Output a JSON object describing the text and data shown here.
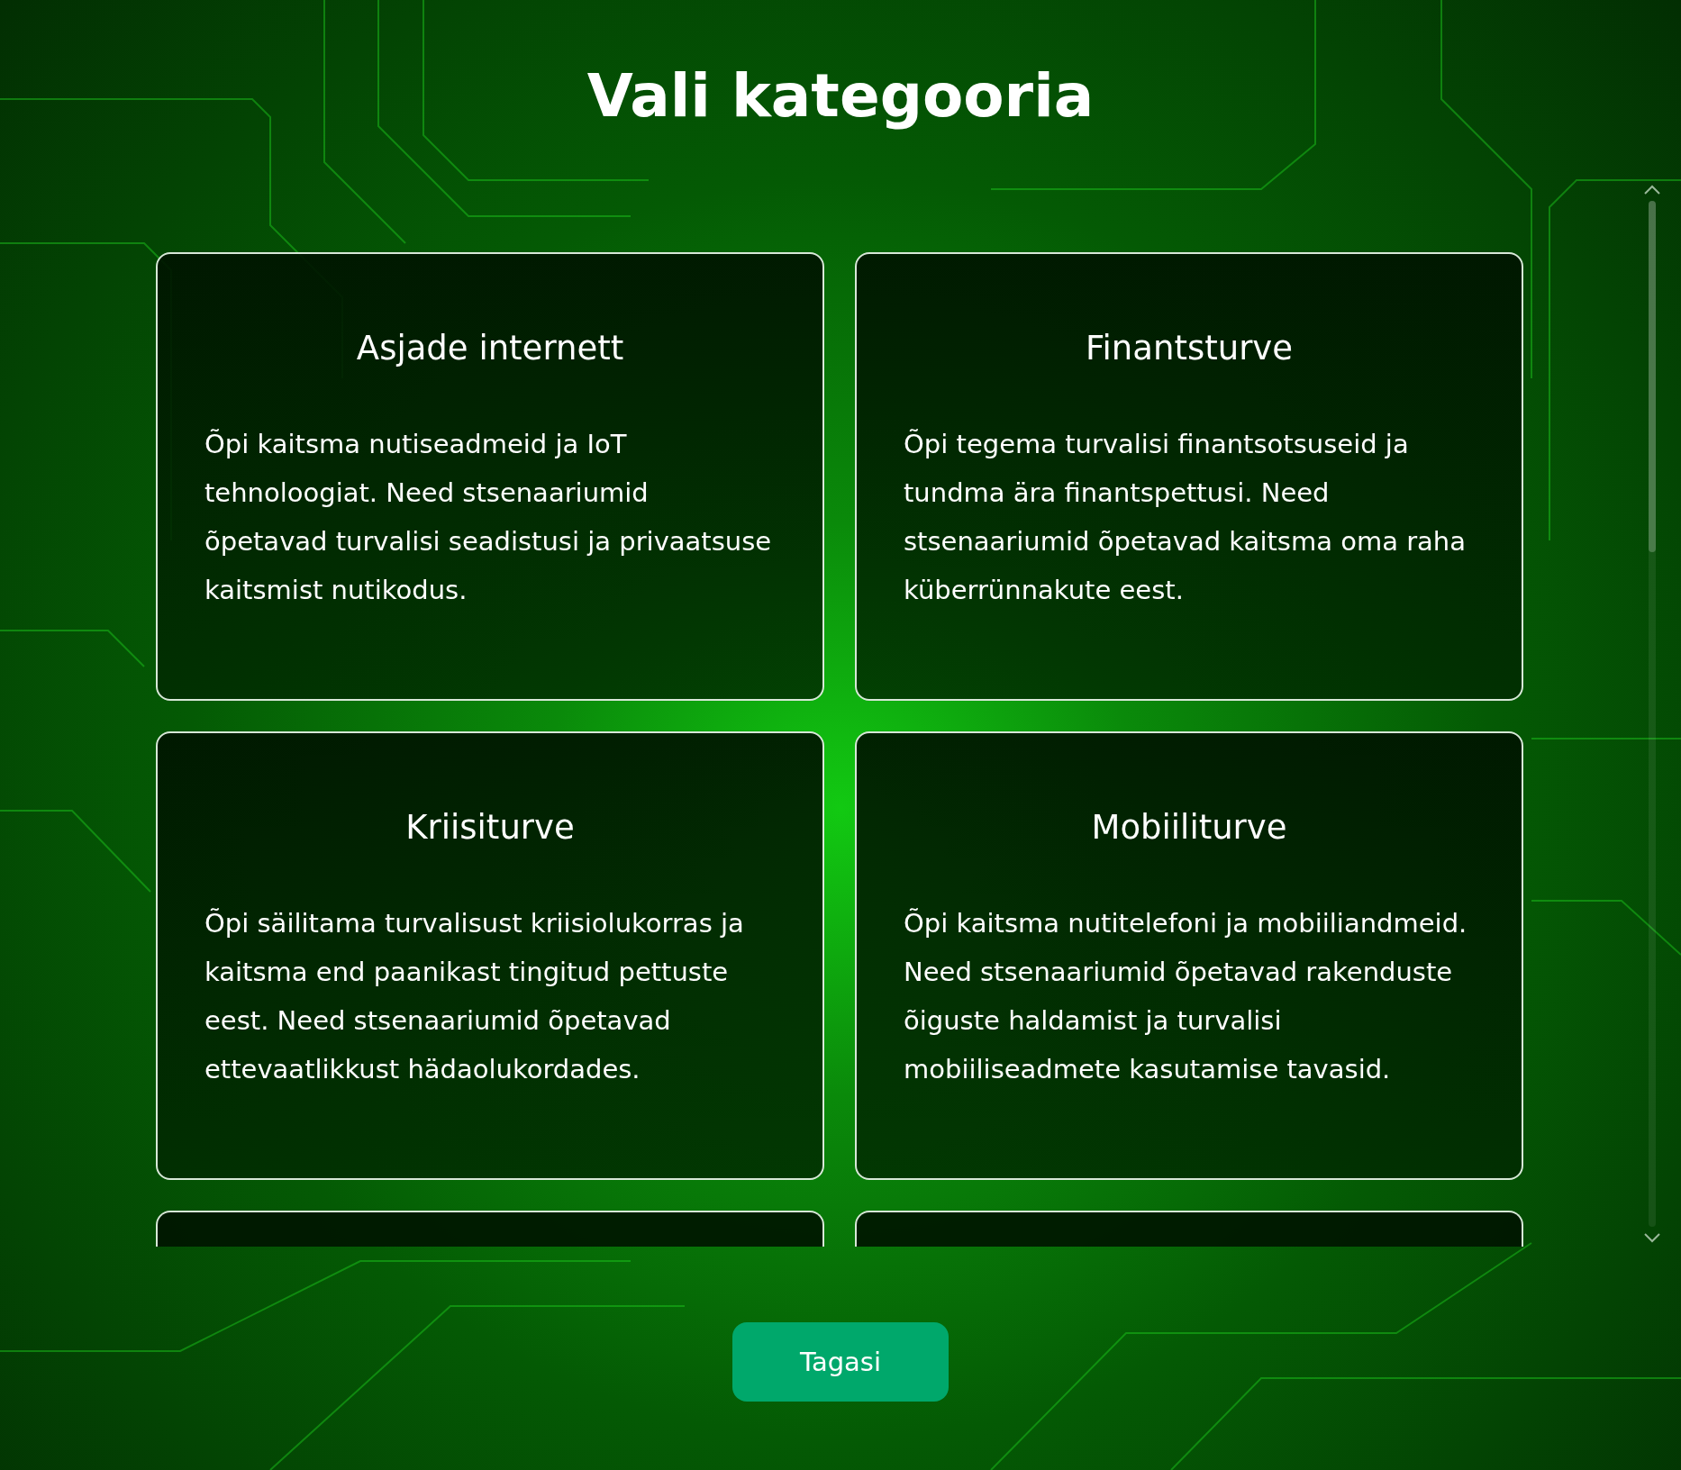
{
  "title": "Vali kategooria",
  "categories": [
    {
      "name": "Asjade internett",
      "description": "Õpi kaitsma nutiseadmeid ja IoT tehnoloogiat. Need stsenaariumid õpetavad turvalisi seadistusi ja privaatsuse kaitsmist nutikodus."
    },
    {
      "name": "Finantsturve",
      "description": "Õpi tegema turvalisi finantsotsuseid ja tundma ära finantspettusi. Need stsenaariumid õpetavad kaitsma oma raha küberrünnakute eest."
    },
    {
      "name": "Kriisiturve",
      "description": "Õpi säilitama turvalisust kriisiolukorras ja kaitsma end paanikast tingitud pettuste eest. Need stsenaariumid õpetavad ettevaatlikkust hädaolukordades."
    },
    {
      "name": "Mobiiliturve",
      "description": "Õpi kaitsma nutitelefoni ja mobiiliandmeid. Need stsenaariumid õpetavad rakenduste õiguste haldamist ja turvalisi mobiiliseadmete kasutamise tavasid."
    }
  ],
  "back_button": "Tagasi"
}
